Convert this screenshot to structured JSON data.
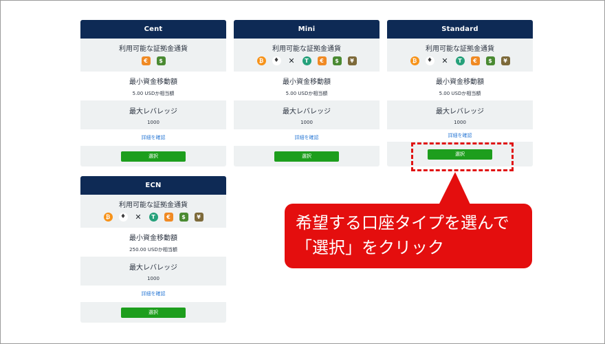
{
  "cards": [
    {
      "title": "Cent",
      "currency_label": "利用可能な証拠金通貨",
      "min_transfer_label": "最小資金移動額",
      "min_transfer_value": "5.00 USDか相当額",
      "max_leverage_label": "最大レバレッジ",
      "max_leverage_value": "1000",
      "details_link": "詳細を確認",
      "select_button": "選択",
      "icons": [
        "euro-icon",
        "dollar-icon"
      ]
    },
    {
      "title": "Mini",
      "currency_label": "利用可能な証拠金通貨",
      "min_transfer_label": "最小資金移動額",
      "min_transfer_value": "5.00 USDか相当額",
      "max_leverage_label": "最大レバレッジ",
      "max_leverage_value": "1000",
      "details_link": "詳細を確認",
      "select_button": "選択",
      "icons": [
        "bitcoin-icon",
        "ethereum-icon",
        "xrp-icon",
        "tether-icon",
        "euro-icon",
        "dollar-icon",
        "yen-icon"
      ]
    },
    {
      "title": "Standard",
      "currency_label": "利用可能な証拠金通貨",
      "min_transfer_label": "最小資金移動額",
      "min_transfer_value": "5.00 USDか相当額",
      "max_leverage_label": "最大レバレッジ",
      "max_leverage_value": "1000",
      "details_link": "詳細を確認",
      "select_button": "選択",
      "icons": [
        "bitcoin-icon",
        "ethereum-icon",
        "xrp-icon",
        "tether-icon",
        "euro-icon",
        "dollar-icon",
        "yen-icon"
      ]
    },
    {
      "title": "ECN",
      "currency_label": "利用可能な証拠金通貨",
      "min_transfer_label": "最小資金移動額",
      "min_transfer_value": "250.00 USDか相当額",
      "max_leverage_label": "最大レバレッジ",
      "max_leverage_value": "1000",
      "details_link": "詳細を確認",
      "select_button": "選択",
      "icons": [
        "bitcoin-icon",
        "ethereum-icon",
        "xrp-icon",
        "tether-icon",
        "euro-icon",
        "dollar-icon",
        "yen-icon"
      ]
    }
  ],
  "callout": {
    "line1": "希望する口座タイプを選んで",
    "line2": "「選択」をクリック"
  },
  "colors": {
    "header": "#0e2a55",
    "button": "#1d9e1d",
    "link": "#2e7bd6",
    "callout": "#e40e0e"
  }
}
